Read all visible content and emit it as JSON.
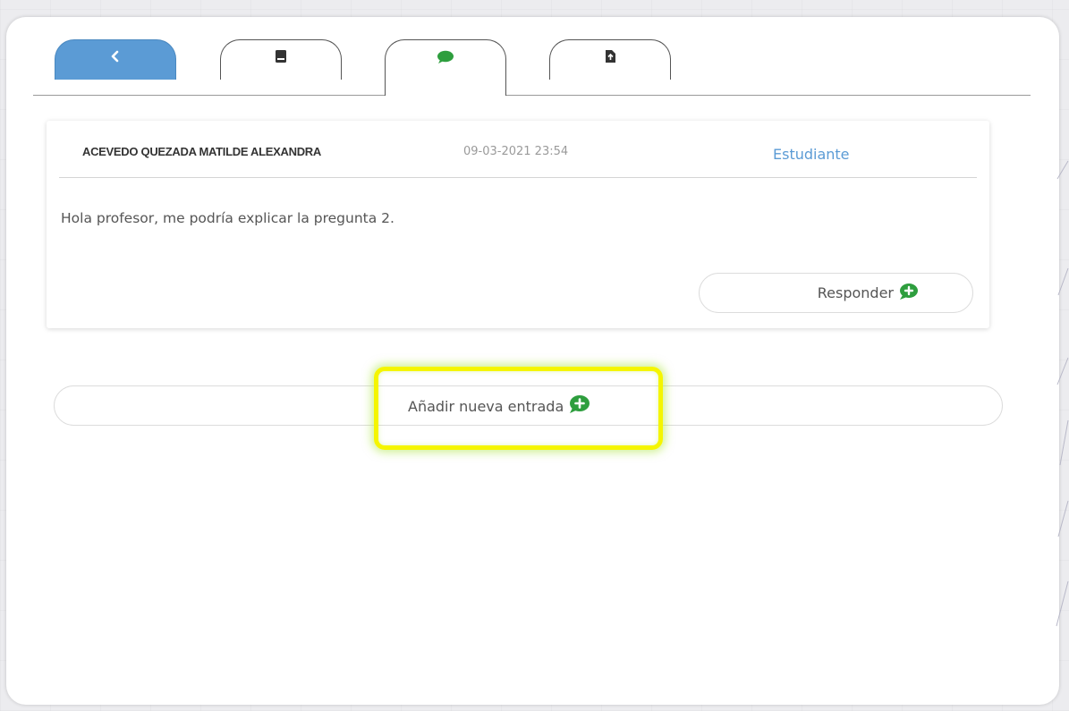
{
  "tabs": [
    {
      "name": "back",
      "icon": "chevron-left-icon",
      "active": false,
      "color": "#5b9bd5"
    },
    {
      "name": "book",
      "icon": "book-icon",
      "active": false
    },
    {
      "name": "comments",
      "icon": "speech-bubble-icon",
      "active": true,
      "icon_color": "#2e9e3e"
    },
    {
      "name": "document",
      "icon": "file-upload-icon",
      "active": false
    }
  ],
  "message": {
    "author": "ACEVEDO QUEZADA MATILDE ALEXANDRA",
    "timestamp": "09-03-2021 23:54",
    "role": "Estudiante",
    "body": "Hola profesor, me podría explicar la pregunta 2.",
    "reply_label": "Responder"
  },
  "add_entry": {
    "label": "Añadir nueva entrada"
  },
  "colors": {
    "accent": "#5b9bd5",
    "icon_green": "#2e9e3e",
    "highlight": "#f5f500"
  }
}
